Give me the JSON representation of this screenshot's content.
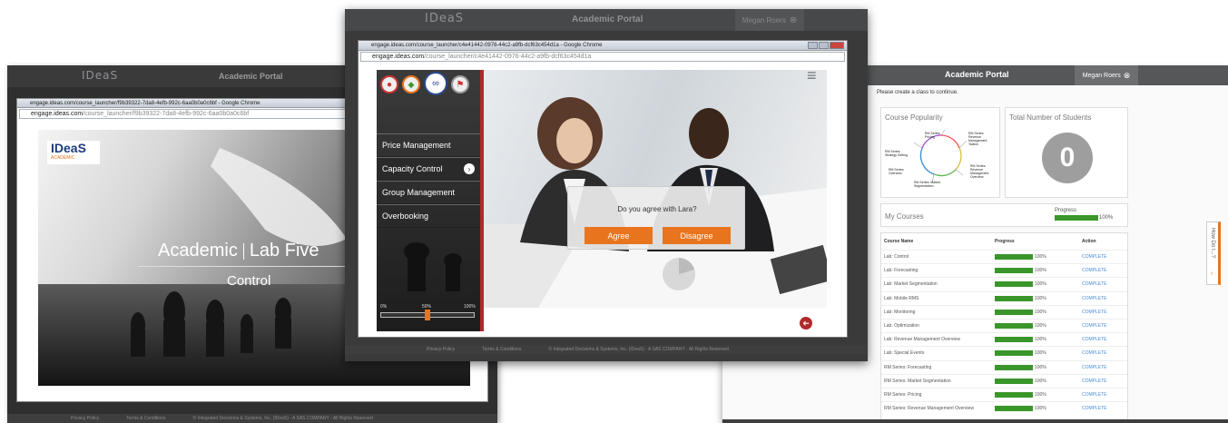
{
  "left": {
    "portal": {
      "logo": "IDeaS",
      "title": "Academic Portal"
    },
    "chrome": {
      "tab_title": "engage.ideas.com/course_launcher/f9b39322-7da8-4efb-992c-6aa0b0a0c6bf - Google Chrome",
      "url_domain": "engage.ideas.com",
      "url_path": "/course_launcher/f9b39322-7da8-4efb-992c-6aa0b0a0c6bf"
    },
    "brand_logo": "IDeaS",
    "brand_sub": "ACADEMIC",
    "heading_left": "Academic",
    "heading_right": "Lab Five",
    "subheading": "Control",
    "footer": {
      "privacy": "Privacy Policy",
      "terms": "Terms & Conditions",
      "copyright": "© Integrated Decisions & Systems, Inc. (IDeaS) - A SAS COMPANY - All Rights Reserved"
    }
  },
  "middle": {
    "portal": {
      "logo": "IDeaS",
      "title": "Academic Portal",
      "user": "Megan Roers",
      "close_glyph": "⊗"
    },
    "chrome": {
      "tab_title": "engage.ideas.com/course_launcher/c4e41442-0976-44c2-a9fb-dcf63c454d1a - Google Chrome",
      "url_domain": "engage.ideas.com",
      "url_path": "/course_launcher/c4e41442-0976-44c2-a9fb-dcf63c454d1a"
    },
    "menu": [
      {
        "label": "Price Management"
      },
      {
        "label": "Capacity Control",
        "active": true
      },
      {
        "label": "Group Management"
      },
      {
        "label": "Overbooking"
      }
    ],
    "progress": {
      "min": "0%",
      "mid": "50%",
      "max": "100%",
      "value": 0.5
    },
    "dialog": {
      "question": "Do you agree with Lara?",
      "agree": "Agree",
      "disagree": "Disagree"
    },
    "hamburger_glyph": "≡",
    "back_glyph": "➜",
    "footer": {
      "privacy": "Privacy Policy",
      "terms": "Terms & Conditions",
      "copyright": "© Integrated Decisions & Systems, Inc. (IDeaS) - A SAS COMPANY - All Rights Reserved"
    }
  },
  "right": {
    "portal": {
      "title": "Academic Portal",
      "user": "Megan Roers",
      "close_glyph": "⊗"
    },
    "notice": "Please create a class to continue.",
    "popularity": {
      "title": "Course Popularity",
      "labels": [
        "RM Series: Pricing",
        "RM Series: Revenue Management Tactics",
        "RM Series: Strategy Setting",
        "RM Series: Overview",
        "RM Series: Market Segmentation",
        "RM Series: Revenue Management Overview"
      ]
    },
    "students": {
      "title": "Total Number of Students",
      "count": "0"
    },
    "my_courses": {
      "title": "My Courses",
      "progress_label": "Progress",
      "progress_value": "100%",
      "progress": 1.0
    },
    "table": {
      "headers": [
        "Course Name",
        "Progress",
        "Action"
      ],
      "rows": [
        {
          "name": "Lab: Control",
          "progress": "100%",
          "action": "COMPLETE"
        },
        {
          "name": "Lab: Forecasting",
          "progress": "100%",
          "action": "COMPLETE"
        },
        {
          "name": "Lab: Market Segmentation",
          "progress": "100%",
          "action": "COMPLETE"
        },
        {
          "name": "Lab: Mobile RMS",
          "progress": "100%",
          "action": "COMPLETE"
        },
        {
          "name": "Lab: Monitoring",
          "progress": "100%",
          "action": "COMPLETE"
        },
        {
          "name": "Lab: Optimization",
          "progress": "100%",
          "action": "COMPLETE"
        },
        {
          "name": "Lab: Revenue Management Overview",
          "progress": "100%",
          "action": "COMPLETE"
        },
        {
          "name": "Lab: Special Events",
          "progress": "100%",
          "action": "COMPLETE"
        },
        {
          "name": "RM Series: Forecasting",
          "progress": "100%",
          "action": "COMPLETE"
        },
        {
          "name": "RM Series: Market Segmentation",
          "progress": "100%",
          "action": "COMPLETE"
        },
        {
          "name": "RM Series: Pricing",
          "progress": "100%",
          "action": "COMPLETE"
        },
        {
          "name": "RM Series: Revenue Management Overview",
          "progress": "100%",
          "action": "COMPLETE"
        }
      ]
    },
    "howdo": "How Do I...?",
    "collapse_glyph": "‹"
  },
  "colors": {
    "accent": "#e8741e",
    "portal_bar": "#4c4e50",
    "progress_green": "#3a962a",
    "link_blue": "#4a8bd6",
    "menu_red": "#b02a2a"
  }
}
